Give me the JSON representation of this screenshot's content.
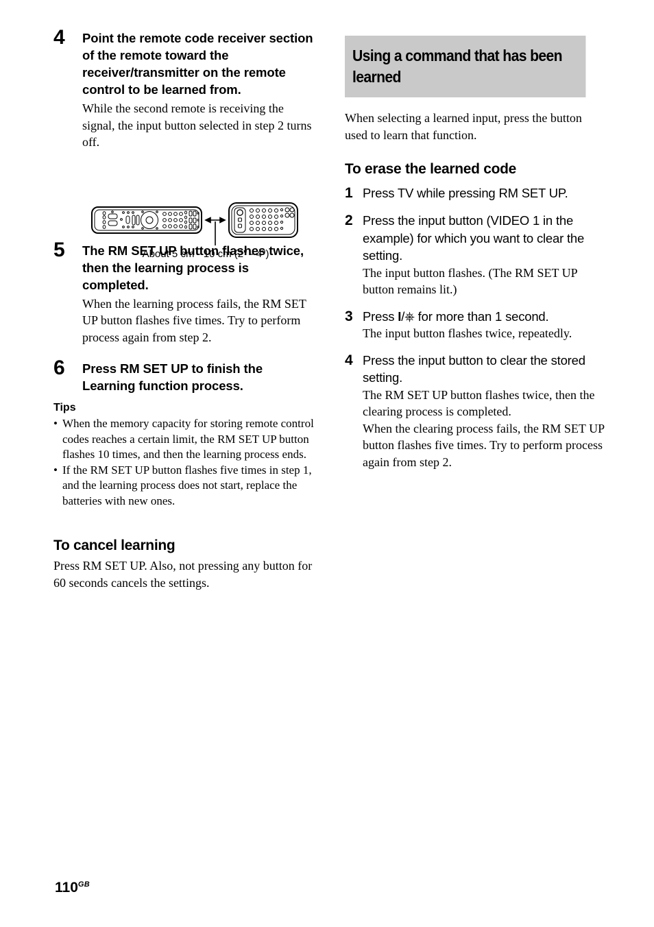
{
  "page": {
    "number": "110",
    "region_code": "GB"
  },
  "left_column": {
    "steps": [
      {
        "number": "4",
        "title": "Point the remote code receiver section of the remote toward the receiver/transmitter on the remote control to be learned from.",
        "note": "While the second remote is receiving the signal, the input button selected in step 2 turns off."
      },
      {
        "number": "5",
        "title": "The RM SET UP button flashes twice, then the learning process is completed.",
        "note": "When the learning process fails, the RM SET UP button flashes five times. Try to perform process again from step 2."
      },
      {
        "number": "6",
        "title": "Press RM SET UP to finish the Learning function process.",
        "note": ""
      }
    ],
    "diagram": {
      "caption": "About 5 cm - 10 cm (2\" - 4\")",
      "left_device": "learning-remote-control",
      "right_device": "source-remote-control",
      "arrow": "double-headed-distance-arrow"
    },
    "tips": {
      "title": "Tips",
      "items": [
        "When the memory capacity for storing remote control codes reaches a certain limit, the RM SET UP button flashes 10 times, and then the learning process ends.",
        "If the RM SET UP button flashes five times in step 1, and the learning process does not start, replace the batteries with new ones."
      ],
      "bullet": "•"
    },
    "cancel_section": {
      "heading": "To cancel learning",
      "body": "Press RM SET UP. Also, not pressing any button for 60 seconds cancels the settings."
    }
  },
  "right_column": {
    "band_heading": "Using a command that has been learned",
    "band_color": "#c9c9c9",
    "intro": "When selecting a learned input, press the button used to learn that function.",
    "erase_section": {
      "heading": "To erase the learned code",
      "steps": [
        {
          "number": "1",
          "title": "Press TV while pressing RM SET UP.",
          "notes": []
        },
        {
          "number": "2",
          "title": "Press the input button (VIDEO 1 in the example) for which you want to clear the setting.",
          "notes": [
            "The input button flashes. (The RM SET UP button remains lit.)"
          ]
        },
        {
          "number": "3",
          "title_prefix": "Press ",
          "title_symbol": "I/⏻",
          "title_suffix": " for more than 1 second.",
          "notes": [
            "The input button flashes twice, repeatedly."
          ]
        },
        {
          "number": "4",
          "title": "Press the input button to clear the stored setting.",
          "notes": [
            "The RM SET UP button flashes twice, then the clearing process is completed.",
            "When the clearing process fails, the RM SET UP button flashes five times. Try to perform process again from step 2."
          ]
        }
      ]
    }
  }
}
